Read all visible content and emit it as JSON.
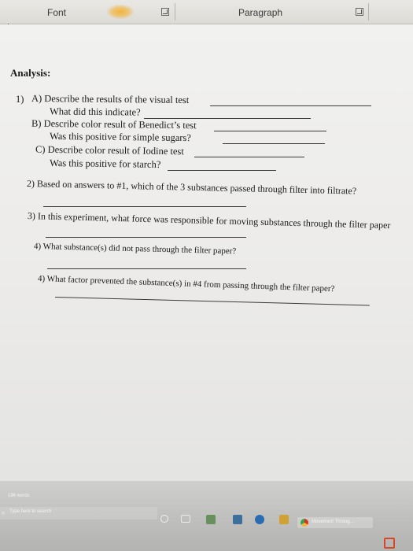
{
  "ribbon": {
    "font_label": "Font",
    "paragraph_label": "Paragraph"
  },
  "document": {
    "heading": "Analysis:",
    "q1a_marker": "1)",
    "q1a": "A) Describe the results of the visual test",
    "q1a_sub": "What did this indicate?",
    "q1b": "B) Describe color result of Benedict’s test",
    "q1b_sub": "Was this positive for simple sugars?",
    "q1c": "C) Describe color result of Iodine test",
    "q1c_sub": "Was this positive for starch?",
    "q2": "2)  Based on answers to #1, which of the 3 substances passed through filter into filtrate?",
    "q3": "3)  In this experiment, what force was responsible for moving substances through the filter paper",
    "q4a": "4) What substance(s) did not pass through the filter paper?",
    "q4b": "4)   What factor prevented the substance(s) in #4 from passing through the filter paper?"
  },
  "taskbar": {
    "word_count": "196 words",
    "search_placeholder": "Type here to search",
    "app_window_label": "Movement Throug..."
  },
  "colors": {
    "chrome_orange": "#f2b43a",
    "chrome_green": "#2fa84f",
    "office_red": "#d9472b",
    "word_blue": "#2b579a"
  }
}
